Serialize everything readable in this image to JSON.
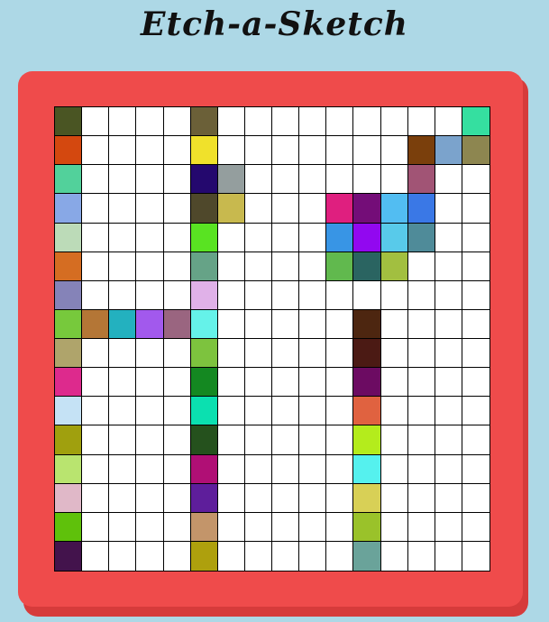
{
  "title": "Etch-a-Sketch",
  "grid": {
    "rows": 16,
    "cols": 16,
    "cells": [
      [
        "#4a5523",
        "#ffffff",
        "#ffffff",
        "#ffffff",
        "#ffffff",
        "#6b6038",
        "#ffffff",
        "#ffffff",
        "#ffffff",
        "#ffffff",
        "#ffffff",
        "#ffffff",
        "#ffffff",
        "#ffffff",
        "#ffffff",
        "#35dfa0"
      ],
      [
        "#d4480f",
        "#ffffff",
        "#ffffff",
        "#ffffff",
        "#ffffff",
        "#f0e12b",
        "#ffffff",
        "#ffffff",
        "#ffffff",
        "#ffffff",
        "#ffffff",
        "#ffffff",
        "#ffffff",
        "#7a3f0c",
        "#7ba3cc",
        "#8d8650"
      ],
      [
        "#52d19b",
        "#ffffff",
        "#ffffff",
        "#ffffff",
        "#ffffff",
        "#24086e",
        "#949e9e",
        "#ffffff",
        "#ffffff",
        "#ffffff",
        "#ffffff",
        "#ffffff",
        "#ffffff",
        "#a15475",
        "#ffffff",
        "#ffffff"
      ],
      [
        "#88a8e6",
        "#ffffff",
        "#ffffff",
        "#ffffff",
        "#ffffff",
        "#4f482b",
        "#c8b94e",
        "#ffffff",
        "#ffffff",
        "#ffffff",
        "#df1f7f",
        "#740d78",
        "#52bdf2",
        "#3a78e6",
        "#ffffff",
        "#ffffff"
      ],
      [
        "#bcdbb8",
        "#ffffff",
        "#ffffff",
        "#ffffff",
        "#ffffff",
        "#59e322",
        "#ffffff",
        "#ffffff",
        "#ffffff",
        "#ffffff",
        "#3895e5",
        "#9208f0",
        "#58caea",
        "#4f8b99",
        "#ffffff",
        "#ffffff"
      ],
      [
        "#d56d22",
        "#ffffff",
        "#ffffff",
        "#ffffff",
        "#ffffff",
        "#66a387",
        "#ffffff",
        "#ffffff",
        "#ffffff",
        "#ffffff",
        "#61b94e",
        "#2a6461",
        "#a2bf40",
        "#ffffff",
        "#ffffff",
        "#ffffff"
      ],
      [
        "#8583b8",
        "#ffffff",
        "#ffffff",
        "#ffffff",
        "#ffffff",
        "#e0b1e8",
        "#ffffff",
        "#ffffff",
        "#ffffff",
        "#ffffff",
        "#ffffff",
        "#ffffff",
        "#ffffff",
        "#ffffff",
        "#ffffff",
        "#ffffff"
      ],
      [
        "#77c93c",
        "#b47636",
        "#23b1bf",
        "#a259ed",
        "#9a6580",
        "#65f2e9",
        "#ffffff",
        "#ffffff",
        "#ffffff",
        "#ffffff",
        "#ffffff",
        "#4d2610",
        "#ffffff",
        "#ffffff",
        "#ffffff",
        "#ffffff"
      ],
      [
        "#afa46b",
        "#ffffff",
        "#ffffff",
        "#ffffff",
        "#ffffff",
        "#7dc33e",
        "#ffffff",
        "#ffffff",
        "#ffffff",
        "#ffffff",
        "#ffffff",
        "#4b1a14",
        "#ffffff",
        "#ffffff",
        "#ffffff",
        "#ffffff"
      ],
      [
        "#dd2a8d",
        "#ffffff",
        "#ffffff",
        "#ffffff",
        "#ffffff",
        "#148821",
        "#ffffff",
        "#ffffff",
        "#ffffff",
        "#ffffff",
        "#ffffff",
        "#6c0b62",
        "#ffffff",
        "#ffffff",
        "#ffffff",
        "#ffffff"
      ],
      [
        "#c5e2f5",
        "#ffffff",
        "#ffffff",
        "#ffffff",
        "#ffffff",
        "#0be0b0",
        "#ffffff",
        "#ffffff",
        "#ffffff",
        "#ffffff",
        "#ffffff",
        "#e06240",
        "#ffffff",
        "#ffffff",
        "#ffffff",
        "#ffffff"
      ],
      [
        "#a0a00e",
        "#ffffff",
        "#ffffff",
        "#ffffff",
        "#ffffff",
        "#25511d",
        "#ffffff",
        "#ffffff",
        "#ffffff",
        "#ffffff",
        "#ffffff",
        "#b4ec1c",
        "#ffffff",
        "#ffffff",
        "#ffffff",
        "#ffffff"
      ],
      [
        "#b9e46f",
        "#ffffff",
        "#ffffff",
        "#ffffff",
        "#ffffff",
        "#b00f75",
        "#ffffff",
        "#ffffff",
        "#ffffff",
        "#ffffff",
        "#ffffff",
        "#55f1ee",
        "#ffffff",
        "#ffffff",
        "#ffffff",
        "#ffffff"
      ],
      [
        "#e0b8c8",
        "#ffffff",
        "#ffffff",
        "#ffffff",
        "#ffffff",
        "#5e1e9b",
        "#ffffff",
        "#ffffff",
        "#ffffff",
        "#ffffff",
        "#ffffff",
        "#d8d056",
        "#ffffff",
        "#ffffff",
        "#ffffff",
        "#ffffff"
      ],
      [
        "#5fc10b",
        "#ffffff",
        "#ffffff",
        "#ffffff",
        "#ffffff",
        "#c3956a",
        "#ffffff",
        "#ffffff",
        "#ffffff",
        "#ffffff",
        "#ffffff",
        "#9ac22a",
        "#ffffff",
        "#ffffff",
        "#ffffff",
        "#ffffff"
      ],
      [
        "#43134c",
        "#ffffff",
        "#ffffff",
        "#ffffff",
        "#ffffff",
        "#aea00d",
        "#ffffff",
        "#ffffff",
        "#ffffff",
        "#ffffff",
        "#ffffff",
        "#6aa39a",
        "#ffffff",
        "#ffffff",
        "#ffffff",
        "#ffffff"
      ]
    ]
  },
  "colors": {
    "background": "#add8e6",
    "frame": "#ef4b4b",
    "frame_shadow": "#d63b3b",
    "grid_line": "#000000",
    "empty_cell": "#ffffff"
  }
}
